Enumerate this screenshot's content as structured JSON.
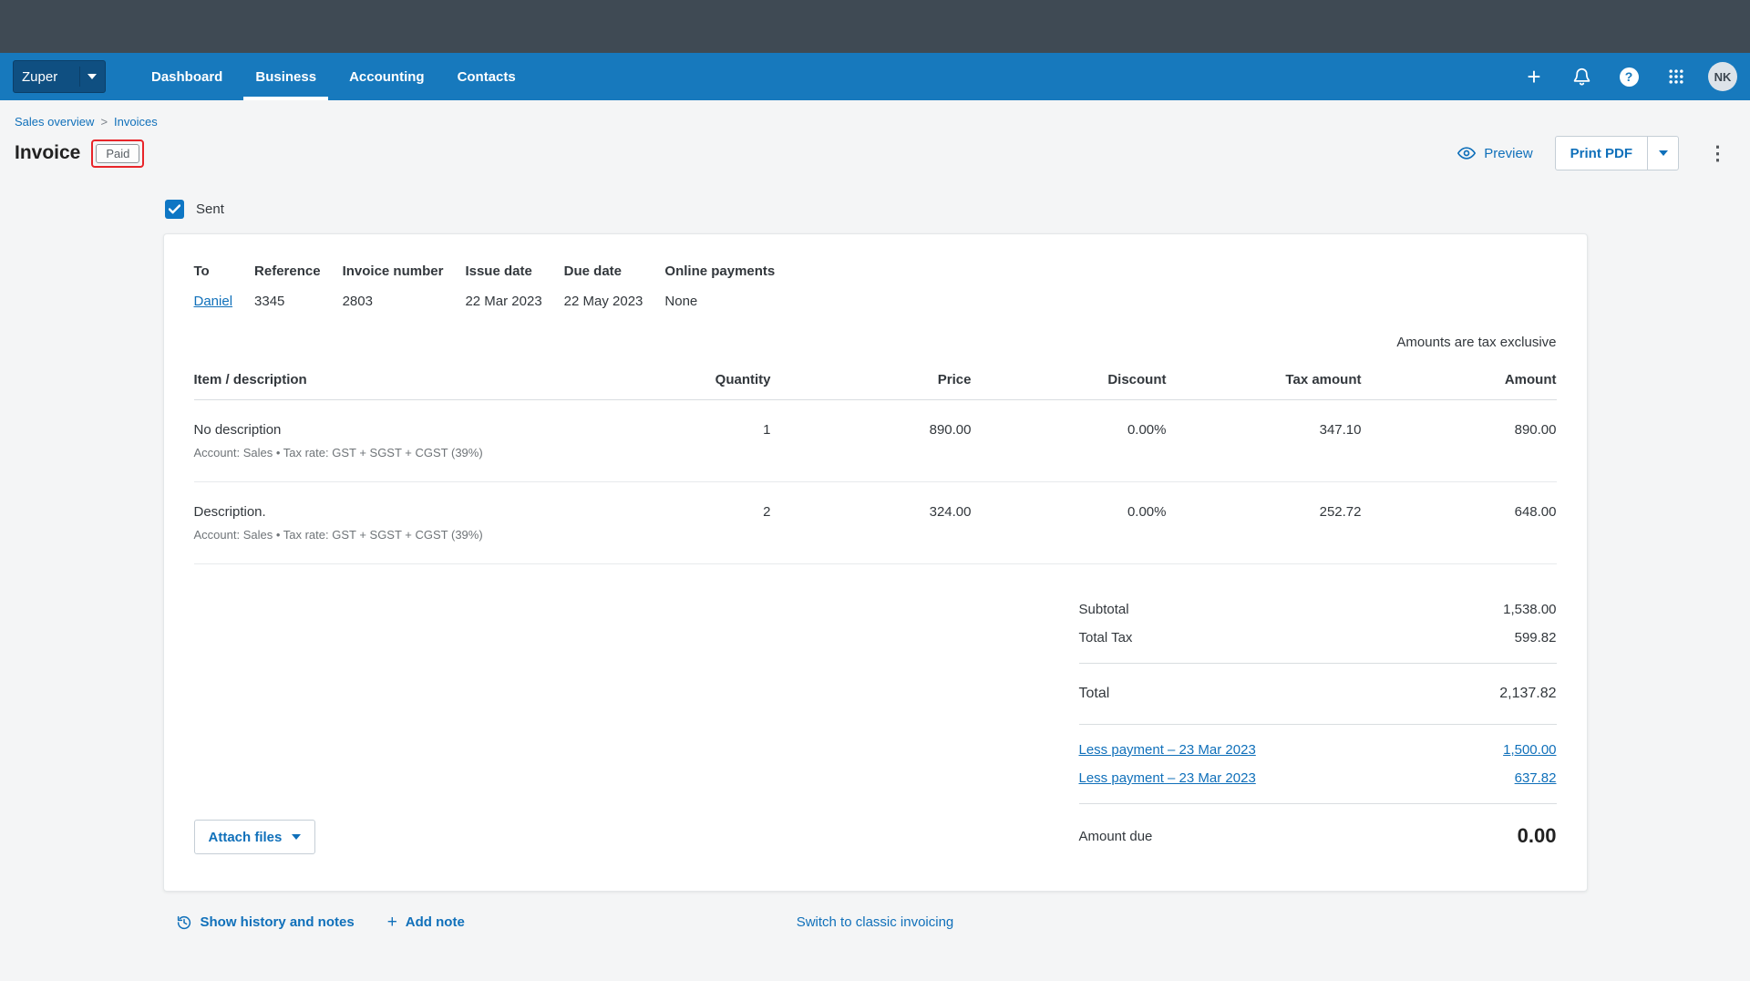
{
  "app": {
    "topbar_dark": "#3f4a54",
    "nav_blue": "#1779bd",
    "link_blue": "#1070ba",
    "annotation_red": "#e8252a",
    "page_bg": "#f4f5f6"
  },
  "topnav": {
    "org_name": "Zuper",
    "items": [
      {
        "label": "Dashboard"
      },
      {
        "label": "Business"
      },
      {
        "label": "Accounting"
      },
      {
        "label": "Contacts"
      }
    ],
    "plus_glyph": "+",
    "help_glyph": "?",
    "avatar_initials": "NK"
  },
  "breadcrumb": {
    "items": [
      "Sales overview",
      "Invoices"
    ],
    "separator": ">"
  },
  "header": {
    "title": "Invoice",
    "status_badge": "Paid",
    "preview_label": "Preview",
    "print_pdf_label": "Print PDF",
    "kebab_glyph": "⋮"
  },
  "sent": {
    "label": "Sent",
    "checked": true
  },
  "invoice": {
    "fields": [
      {
        "label": "To",
        "value": "Daniel"
      },
      {
        "label": "Reference",
        "value": "3345"
      },
      {
        "label": "Invoice number",
        "value": "2803"
      },
      {
        "label": "Issue date",
        "value": "22 Mar 2023"
      },
      {
        "label": "Due date",
        "value": "22 May 2023"
      },
      {
        "label": "Online payments",
        "value": "None"
      }
    ],
    "tax_note": "Amounts are tax exclusive",
    "table": {
      "headers": {
        "description": "Item / description",
        "quantity": "Quantity",
        "price": "Price",
        "discount": "Discount",
        "tax_amount": "Tax amount",
        "amount": "Amount"
      },
      "rows": [
        {
          "description": "No description",
          "details": "Account: Sales • Tax rate: GST + SGST + CGST (39%)",
          "quantity": "1",
          "price": "890.00",
          "discount": "0.00%",
          "tax_amount": "347.10",
          "amount": "890.00"
        },
        {
          "description": "Description.",
          "details": "Account: Sales • Tax rate: GST + SGST + CGST (39%)",
          "quantity": "2",
          "price": "324.00",
          "discount": "0.00%",
          "tax_amount": "252.72",
          "amount": "648.00"
        }
      ]
    },
    "totals": {
      "subtotal_label": "Subtotal",
      "subtotal_value": "1,538.00",
      "total_tax_label": "Total Tax",
      "total_tax_value": "599.82",
      "total_label": "Total",
      "total_value": "2,137.82",
      "payments": [
        {
          "label": "Less payment – 23 Mar 2023",
          "amount": "1,500.00"
        },
        {
          "label": "Less payment – 23 Mar 2023",
          "amount": "637.82"
        }
      ],
      "amount_due_label": "Amount due",
      "amount_due_value": "0.00"
    },
    "attach_files_label": "Attach files"
  },
  "footer": {
    "history_label": "Show history and notes",
    "add_note_plus": "+",
    "add_note_label": "Add note",
    "switch_label": "Switch to classic invoicing"
  }
}
